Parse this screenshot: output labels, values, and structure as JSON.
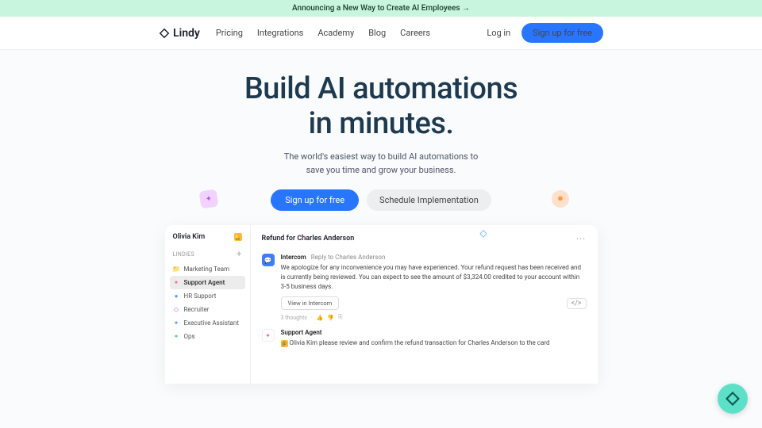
{
  "banner": {
    "text": "Announcing a New Way to Create AI Employees  →"
  },
  "nav": {
    "brand": "Lindy",
    "links": [
      "Pricing",
      "Integrations",
      "Academy",
      "Blog",
      "Careers"
    ],
    "login": "Log in",
    "signup": "Sign up for free"
  },
  "hero": {
    "title_l1": "Build AI automations",
    "title_l2": "in minutes.",
    "sub_l1": "The world's easiest way to build AI automations to",
    "sub_l2": "save you time and grow your business.",
    "cta1": "Sign up for free",
    "cta2": "Schedule Implementation"
  },
  "sidebar": {
    "user": "Olivia Kim",
    "section": "LINDIES",
    "items": [
      {
        "icon": "📁",
        "label": "Marketing Team",
        "color": "#999"
      },
      {
        "icon": "✦",
        "label": "Support Agent",
        "color": "#ff6b8a",
        "active": true
      },
      {
        "icon": "●",
        "label": "HR Support",
        "color": "#4a9fff"
      },
      {
        "icon": "◇",
        "label": "Recruiter",
        "color": "#b855ff"
      },
      {
        "icon": "✦",
        "label": "Executive Assistant",
        "color": "#4a9fff"
      },
      {
        "icon": "✦",
        "label": "Ops",
        "color": "#4fd88a"
      }
    ]
  },
  "main": {
    "title": "Refund for Charles Anderson",
    "msg1": {
      "from": "Intercom",
      "sub": "Reply to Charles Anderson",
      "text": "We apologize for any inconvenience you may have experienced. Your refund request has been received and is currently being reviewed. You can expect to see the amount of $3,324.00 credited to your account within 3-5 business days.",
      "btn": "View in Intercom",
      "meta": "3 thoughts"
    },
    "msg2": {
      "from": "Support Agent",
      "mention": "Olivia Kim",
      "text": " please review and confirm the refund transaction for Charles Anderson to the card"
    }
  }
}
